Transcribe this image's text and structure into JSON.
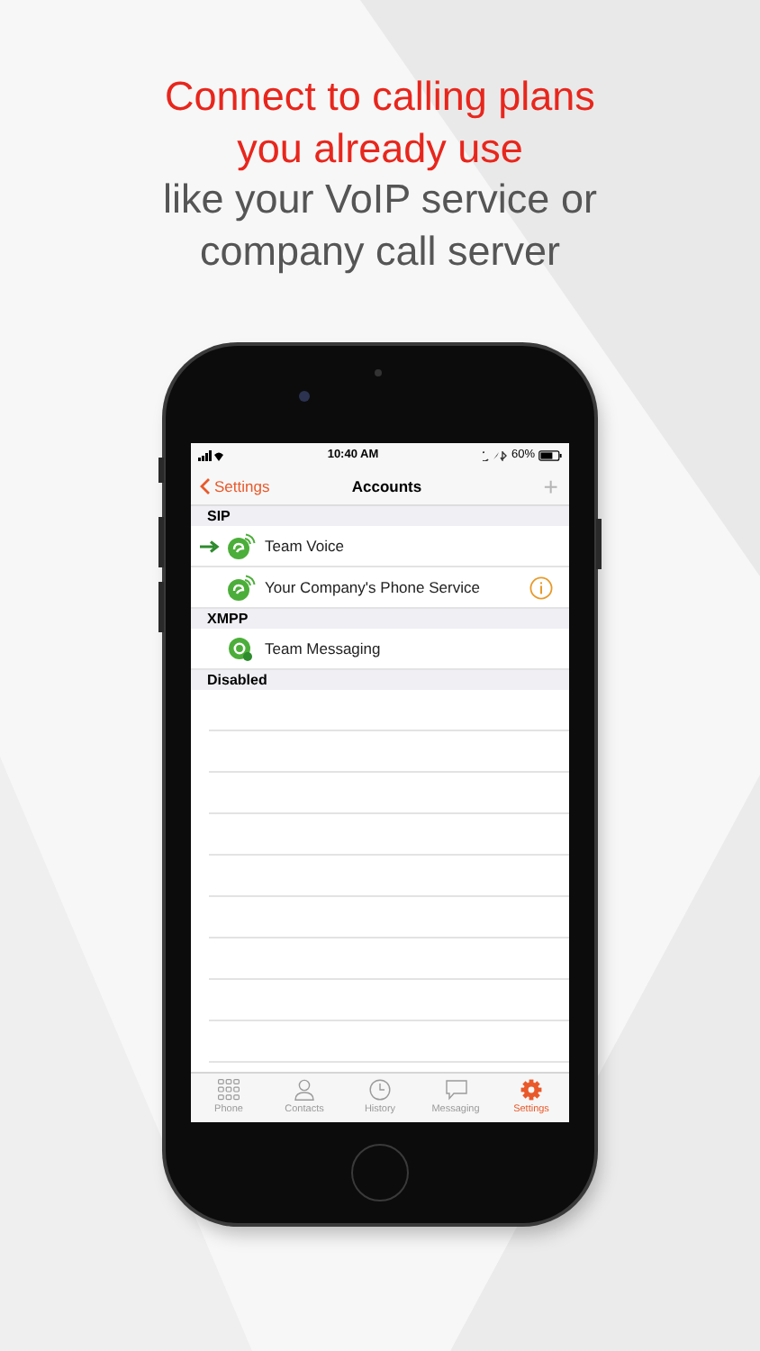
{
  "headline": [
    {
      "text": "Connect to calling plans",
      "kind": "emphasis"
    },
    {
      "text": "you already use",
      "kind": "emphasis"
    },
    {
      "text": "like your VoIP service or",
      "kind": "plain"
    },
    {
      "text": "company call server",
      "kind": "plain"
    }
  ],
  "status_bar": {
    "time": "10:40 AM",
    "battery": "60%"
  },
  "nav": {
    "back": "Settings",
    "title": "Accounts",
    "add": "+",
    "add_disabled": true
  },
  "sections": [
    {
      "title": "SIP",
      "accounts": [
        {
          "name": "Team Voice",
          "kind": "sip",
          "default": true,
          "warning": false
        },
        {
          "name": "Your Company's Phone Service",
          "kind": "sip",
          "default": false,
          "warning": true
        }
      ]
    },
    {
      "title": "XMPP",
      "accounts": [
        {
          "name": "Team Messaging",
          "kind": "xmpp",
          "default": false,
          "warning": false
        }
      ]
    },
    {
      "title": "Disabled"
    }
  ],
  "tabs": [
    {
      "label": "Phone",
      "kind": "keypad",
      "selected": false
    },
    {
      "label": "Contacts",
      "kind": "person",
      "selected": false
    },
    {
      "label": "History",
      "kind": "clock",
      "selected": false
    },
    {
      "label": "Messaging",
      "kind": "bubble",
      "selected": false
    },
    {
      "label": "Settings",
      "kind": "gear",
      "selected": true
    }
  ]
}
